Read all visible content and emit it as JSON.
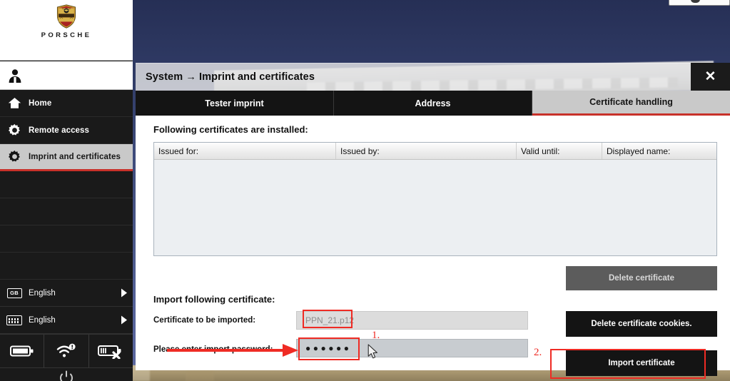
{
  "brand": {
    "wordmark": "PORSCHE",
    "logo_icon": "porsche-crest-icon",
    "user_icon": "user-person-icon"
  },
  "colors": {
    "accent_red": "#c8312a",
    "annotation_red": "#ef2b24",
    "sidebar_bg": "#1a1a1a",
    "active_nav_bg": "#c9c9c9",
    "button_dark": "#141414",
    "button_disabled": "#5c5c5c",
    "field_bg": "#c8ccd0",
    "desktop_blue": "#3d4a7a"
  },
  "sidebar": {
    "items": [
      {
        "label": "Home",
        "icon": "home-icon",
        "active": false
      },
      {
        "label": "Remote access",
        "icon": "gear-icon",
        "active": false
      },
      {
        "label": "Imprint and certificates",
        "icon": "gear-icon",
        "active": true
      }
    ],
    "empty_row_count": 4,
    "language_rows": [
      {
        "label": "English",
        "icon": "flag-gb-icon",
        "badge": "GB",
        "arrow": "chevron-right-icon"
      },
      {
        "label": "English",
        "icon": "keyboard-icon",
        "badge": "",
        "arrow": "chevron-right-icon"
      }
    ],
    "status_icons": [
      {
        "name": "battery-full-icon"
      },
      {
        "name": "wifi-warning-icon"
      },
      {
        "name": "battery-disconnected-icon"
      }
    ],
    "power_icon": "power-button-icon"
  },
  "window": {
    "title": "System → Imprint and certificates",
    "close_label": "✕",
    "close_icon": "close-icon"
  },
  "tabs": [
    {
      "label": "Tester imprint",
      "active": false
    },
    {
      "label": "Address",
      "active": false
    },
    {
      "label": "Certificate handling",
      "active": true
    }
  ],
  "main": {
    "installed_heading": "Following certificates are installed:",
    "import_heading": "Import following certificate:",
    "table": {
      "columns": [
        "Issued for:",
        "Issued by:",
        "Valid until:",
        "Displayed name:"
      ],
      "rows": []
    },
    "fields": [
      {
        "label": "Certificate to be imported:",
        "value": "PPN_21.p12",
        "placeholder": "PPN_21.p12",
        "type": "text"
      },
      {
        "label": "Please enter import password:",
        "value": "●●●●●●",
        "placeholder": "",
        "type": "password"
      }
    ],
    "buttons": [
      {
        "label": "Delete certificate",
        "state": "disabled"
      },
      {
        "label": "Delete certificate cookies.",
        "state": "enabled"
      },
      {
        "label": "Import certificate",
        "state": "enabled",
        "highlighted": true
      }
    ]
  },
  "annotations": {
    "step_one": "1.",
    "step_two": "2.",
    "arrow_icon": "red-arrow-right-icon",
    "cursor_icon": "mouse-pointer-icon"
  }
}
